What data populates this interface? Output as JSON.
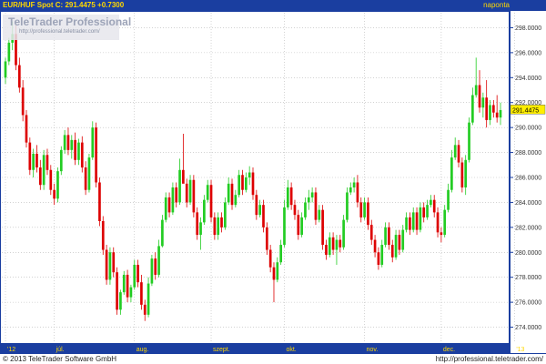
{
  "header": {
    "title": "EUR/HUF Spot C: 291.4475 +0.7300",
    "period": "naponta"
  },
  "watermark": {
    "brand": "TeleTrader Professional",
    "url": "http://professional.teletrader.com/"
  },
  "footer": {
    "copyright": "© 2013 TeleTrader Software GmbH",
    "url": "http://professional.teletrader.com/"
  },
  "colors": {
    "up": "#22cc22",
    "down": "#dd0000",
    "frame": "#1a3ea0",
    "axis_text": "#ffd800",
    "grid": "#b8b8b8"
  },
  "chart_data": {
    "type": "candlestick",
    "last_value": "291.4475",
    "ylim": [
      272.8,
      299.2
    ],
    "y_ticks": [
      "298.0000",
      "296.0000",
      "294.0000",
      "292.0000",
      "290.0000",
      "288.0000",
      "286.0000",
      "284.0000",
      "282.0000",
      "280.0000",
      "278.0000",
      "276.0000",
      "274.0000"
    ],
    "x_labels": [
      {
        "label": "'12",
        "index": 0
      },
      {
        "label": "júl.",
        "index": 14
      },
      {
        "label": "aug.",
        "index": 37
      },
      {
        "label": "szept.",
        "index": 59
      },
      {
        "label": "okt.",
        "index": 80
      },
      {
        "label": "nov.",
        "index": 103
      },
      {
        "label": "dec.",
        "index": 125
      },
      {
        "label": "'13",
        "index": 146
      }
    ],
    "candles": [
      [
        294.0,
        295.6,
        293.5,
        295.3
      ],
      [
        295.3,
        297.2,
        295.0,
        296.8
      ],
      [
        296.8,
        298.5,
        296.2,
        297.5
      ],
      [
        297.5,
        298.2,
        294.6,
        295.0
      ],
      [
        295.0,
        295.6,
        292.8,
        293.2
      ],
      [
        293.2,
        293.8,
        290.5,
        291.0
      ],
      [
        291.0,
        291.4,
        288.4,
        288.8
      ],
      [
        288.8,
        289.2,
        286.2,
        286.6
      ],
      [
        286.6,
        288.3,
        286.0,
        287.9
      ],
      [
        287.9,
        288.6,
        286.4,
        286.8
      ],
      [
        286.8,
        287.4,
        285.0,
        285.4
      ],
      [
        285.4,
        288.2,
        285.0,
        287.8
      ],
      [
        287.8,
        288.3,
        286.2,
        286.6
      ],
      [
        286.6,
        287.0,
        284.6,
        285.0
      ],
      [
        285.0,
        285.5,
        283.8,
        284.3
      ],
      [
        284.3,
        286.8,
        284.0,
        286.5
      ],
      [
        286.5,
        288.5,
        286.2,
        288.2
      ],
      [
        288.2,
        289.8,
        287.9,
        289.4
      ],
      [
        289.4,
        290.0,
        287.8,
        288.2
      ],
      [
        288.2,
        289.4,
        287.5,
        289.0
      ],
      [
        289.0,
        289.6,
        287.0,
        287.4
      ],
      [
        287.4,
        289.1,
        287.0,
        288.8
      ],
      [
        288.8,
        289.3,
        286.4,
        286.8
      ],
      [
        286.8,
        287.3,
        284.6,
        285.0
      ],
      [
        285.0,
        287.9,
        284.8,
        287.6
      ],
      [
        287.6,
        290.5,
        287.4,
        290.0
      ],
      [
        290.0,
        290.4,
        285.2,
        285.6
      ],
      [
        285.6,
        286.0,
        282.1,
        282.5
      ],
      [
        282.5,
        282.9,
        279.8,
        280.2
      ],
      [
        280.2,
        280.6,
        277.4,
        277.8
      ],
      [
        277.8,
        280.4,
        277.4,
        280.0
      ],
      [
        280.0,
        280.4,
        278.0,
        278.4
      ],
      [
        278.4,
        278.8,
        275.0,
        275.4
      ],
      [
        275.4,
        277.0,
        275.0,
        276.8
      ],
      [
        276.8,
        278.5,
        276.6,
        278.2
      ],
      [
        278.2,
        278.6,
        276.0,
        276.4
      ],
      [
        276.4,
        277.4,
        276.0,
        277.2
      ],
      [
        277.2,
        279.4,
        277.0,
        279.0
      ],
      [
        279.0,
        279.4,
        277.2,
        277.6
      ],
      [
        277.6,
        278.2,
        275.4,
        275.8
      ],
      [
        275.8,
        276.2,
        274.5,
        275.0
      ],
      [
        275.0,
        278.0,
        274.8,
        277.5
      ],
      [
        277.5,
        279.8,
        277.3,
        279.5
      ],
      [
        279.5,
        280.0,
        277.8,
        278.2
      ],
      [
        278.2,
        281.0,
        278.0,
        280.5
      ],
      [
        280.5,
        283.0,
        280.4,
        282.6
      ],
      [
        282.6,
        284.8,
        282.4,
        284.4
      ],
      [
        284.4,
        284.8,
        282.8,
        283.2
      ],
      [
        283.2,
        285.6,
        283.0,
        285.2
      ],
      [
        285.2,
        285.6,
        283.6,
        284.0
      ],
      [
        284.0,
        287.5,
        283.8,
        286.6
      ],
      [
        286.6,
        289.5,
        286.4,
        285.5
      ],
      [
        285.5,
        285.9,
        283.6,
        284.0
      ],
      [
        284.0,
        286.2,
        283.8,
        285.8
      ],
      [
        285.8,
        286.2,
        282.8,
        283.2
      ],
      [
        283.2,
        283.6,
        281.0,
        281.4
      ],
      [
        281.4,
        282.8,
        280.2,
        282.4
      ],
      [
        282.4,
        284.6,
        282.2,
        284.2
      ],
      [
        284.2,
        285.8,
        284.0,
        285.4
      ],
      [
        285.4,
        285.8,
        282.4,
        282.8
      ],
      [
        282.8,
        283.2,
        281.0,
        281.4
      ],
      [
        281.4,
        283.2,
        281.0,
        282.8
      ],
      [
        282.8,
        283.2,
        281.6,
        282.0
      ],
      [
        282.0,
        284.4,
        281.8,
        284.0
      ],
      [
        284.0,
        286.0,
        283.8,
        285.5
      ],
      [
        285.5,
        285.9,
        283.4,
        283.8
      ],
      [
        283.8,
        285.0,
        283.6,
        284.6
      ],
      [
        284.6,
        286.6,
        284.4,
        286.2
      ],
      [
        286.2,
        286.6,
        284.6,
        285.0
      ],
      [
        285.0,
        286.4,
        284.8,
        286.0
      ],
      [
        286.0,
        286.9,
        285.4,
        286.4
      ],
      [
        286.4,
        286.8,
        284.2,
        284.6
      ],
      [
        284.6,
        285.0,
        282.6,
        283.0
      ],
      [
        283.0,
        284.2,
        282.8,
        283.8
      ],
      [
        283.8,
        284.2,
        281.6,
        282.0
      ],
      [
        282.0,
        282.4,
        279.8,
        280.2
      ],
      [
        280.2,
        280.6,
        278.4,
        278.8
      ],
      [
        278.8,
        279.2,
        276.0,
        277.8
      ],
      [
        277.8,
        279.6,
        277.6,
        279.2
      ],
      [
        279.2,
        281.0,
        279.0,
        280.6
      ],
      [
        280.6,
        284.2,
        280.4,
        283.6
      ],
      [
        283.6,
        285.8,
        283.4,
        285.2
      ],
      [
        285.2,
        285.6,
        283.4,
        283.8
      ],
      [
        283.8,
        284.2,
        282.6,
        283.0
      ],
      [
        283.0,
        283.4,
        281.0,
        281.4
      ],
      [
        281.4,
        283.2,
        281.2,
        282.8
      ],
      [
        282.8,
        284.4,
        282.6,
        284.0
      ],
      [
        284.0,
        285.0,
        283.4,
        284.4
      ],
      [
        284.4,
        285.2,
        284.0,
        284.8
      ],
      [
        284.8,
        285.2,
        282.2,
        282.6
      ],
      [
        282.6,
        283.8,
        282.4,
        283.4
      ],
      [
        283.4,
        283.8,
        280.2,
        280.6
      ],
      [
        280.6,
        281.0,
        279.4,
        279.8
      ],
      [
        279.8,
        281.6,
        279.6,
        281.2
      ],
      [
        281.2,
        281.6,
        279.8,
        280.2
      ],
      [
        280.2,
        281.4,
        279.0,
        281.0
      ],
      [
        281.0,
        281.4,
        280.0,
        280.4
      ],
      [
        280.4,
        283.0,
        280.2,
        282.6
      ],
      [
        282.6,
        285.2,
        282.4,
        284.8
      ],
      [
        284.8,
        285.6,
        284.6,
        285.2
      ],
      [
        285.2,
        286.0,
        284.8,
        285.6
      ],
      [
        285.6,
        286.2,
        283.6,
        284.0
      ],
      [
        284.0,
        284.4,
        282.4,
        282.8
      ],
      [
        282.8,
        284.4,
        282.6,
        284.0
      ],
      [
        284.0,
        284.4,
        281.8,
        282.2
      ],
      [
        282.2,
        282.6,
        280.6,
        281.0
      ],
      [
        281.0,
        281.4,
        279.6,
        280.0
      ],
      [
        280.0,
        280.4,
        278.6,
        279.0
      ],
      [
        279.0,
        281.0,
        278.8,
        280.6
      ],
      [
        280.6,
        282.4,
        280.4,
        282.0
      ],
      [
        282.0,
        282.4,
        280.2,
        280.6
      ],
      [
        280.6,
        281.0,
        279.2,
        279.6
      ],
      [
        279.6,
        281.8,
        279.4,
        281.4
      ],
      [
        281.4,
        281.8,
        279.8,
        280.2
      ],
      [
        280.2,
        282.2,
        280.0,
        281.8
      ],
      [
        281.8,
        283.2,
        281.6,
        282.8
      ],
      [
        282.8,
        283.2,
        281.4,
        281.8
      ],
      [
        281.8,
        283.6,
        281.6,
        283.2
      ],
      [
        283.2,
        283.6,
        281.4,
        281.8
      ],
      [
        281.8,
        284.0,
        281.6,
        283.6
      ],
      [
        283.6,
        284.0,
        282.4,
        282.8
      ],
      [
        282.8,
        284.2,
        282.6,
        283.8
      ],
      [
        283.8,
        284.6,
        283.6,
        284.2
      ],
      [
        284.2,
        284.6,
        282.8,
        283.2
      ],
      [
        283.2,
        283.6,
        281.2,
        281.6
      ],
      [
        281.6,
        282.0,
        280.8,
        281.4
      ],
      [
        281.4,
        283.8,
        281.2,
        283.4
      ],
      [
        283.4,
        285.5,
        283.2,
        285.0
      ],
      [
        285.0,
        288.2,
        284.8,
        287.6
      ],
      [
        287.6,
        289.2,
        287.4,
        288.6
      ],
      [
        288.6,
        289.0,
        286.8,
        287.2
      ],
      [
        287.2,
        287.6,
        284.8,
        285.2
      ],
      [
        285.2,
        287.8,
        284.6,
        287.4
      ],
      [
        287.4,
        290.8,
        287.2,
        290.4
      ],
      [
        290.4,
        293.2,
        290.2,
        292.6
      ],
      [
        292.6,
        295.6,
        292.4,
        293.4
      ],
      [
        293.4,
        294.6,
        291.2,
        291.6
      ],
      [
        291.6,
        292.8,
        290.8,
        292.4
      ],
      [
        292.4,
        293.8,
        290.0,
        290.6
      ],
      [
        290.6,
        292.2,
        290.2,
        291.8
      ],
      [
        291.8,
        292.2,
        290.8,
        291.2
      ],
      [
        291.2,
        292.6,
        290.4,
        290.8
      ],
      [
        290.8,
        292.0,
        290.2,
        291.4
      ]
    ]
  }
}
